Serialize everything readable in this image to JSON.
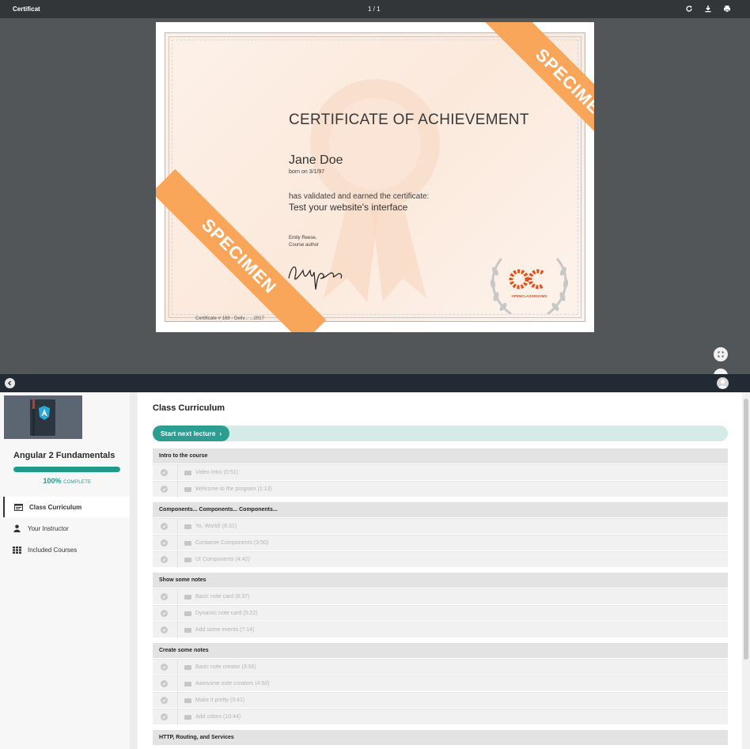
{
  "viewer": {
    "title": "Certificat",
    "page_counter": "1 / 1",
    "icons": [
      "rotate-icon",
      "download-icon",
      "print-icon",
      "fit-page-icon"
    ]
  },
  "certificate": {
    "heading": "CERTIFICATE OF ACHIEVEMENT",
    "name": "Jane Doe",
    "born": "born on 3/1/97",
    "validated_text": "has validated and earned the certificate:",
    "course": "Test your website's interface",
    "author_name": "Emily Reese,",
    "author_role": "Course author",
    "signature": "Emily Reese",
    "number": "Certificate # 188 - Deliv... ...2017",
    "specimen_label": "SPECIMEN",
    "logo_text": "OPENCLASSROOMS",
    "logo_mark": "OC",
    "colors": {
      "specimen": "#f9a65a",
      "paper": "#fbeadf"
    }
  },
  "app": {
    "course_title": "Angular 2 Fundamentals",
    "progress_percent": 100,
    "progress_value_text": "100%",
    "progress_suffix": "COMPLETE",
    "nav": [
      {
        "label": "Class Curriculum",
        "icon": "curriculum-icon",
        "active": true
      },
      {
        "label": "Your Instructor",
        "icon": "person-icon",
        "active": false
      },
      {
        "label": "Included Courses",
        "icon": "grid-icon",
        "active": false
      }
    ],
    "curriculum_title": "Class Curriculum",
    "start_button": "Start next lecture",
    "colors": {
      "accent": "#2e9d91",
      "topbar": "#222a33"
    },
    "sections": [
      {
        "title": "Intro to the course",
        "lectures": [
          "Video Intro (0:51)",
          "Welcome to the program (1:13)"
        ]
      },
      {
        "title": "Components... Components... Components...",
        "lectures": [
          "Yo, World! (8:31)",
          "Container Components (3:50)",
          "UI Components (4:42)"
        ]
      },
      {
        "title": "Show some notes",
        "lectures": [
          "Basic note card (8:37)",
          "Dynamic note card (5:22)",
          "Add some events (7:14)"
        ]
      },
      {
        "title": "Create some notes",
        "lectures": [
          "Basic note creator (3:56)",
          "Awesome note creators (4:50)",
          "Make it pretty (3:41)",
          "Add colors (10:44)"
        ]
      },
      {
        "title": "HTTP, Routing, and Services",
        "lectures": []
      }
    ]
  }
}
